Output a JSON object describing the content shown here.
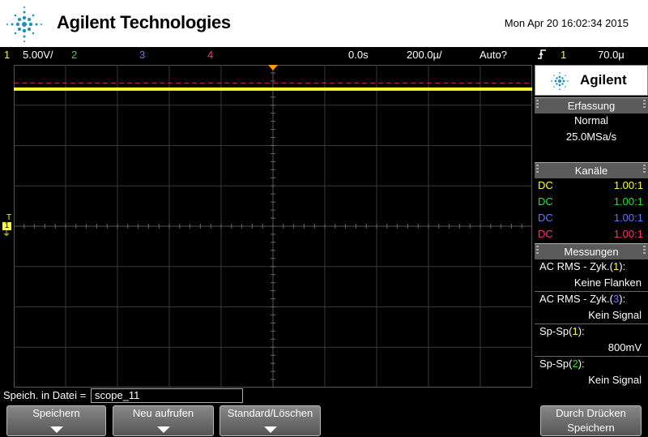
{
  "header": {
    "brand": "Agilent Technologies",
    "datetime": "Mon Apr 20 16:02:34 2015"
  },
  "statusbar": {
    "ch1_num": "1",
    "ch1_scale": "5.00V/",
    "ch2_num": "2",
    "ch3_num": "3",
    "ch4_num": "4",
    "time_delay": "0.0s",
    "time_scale": "200.0µ/",
    "trigger_mode": "Auto?",
    "trigger_icon": "rising-edge-icon",
    "trigger_ch": "1",
    "trigger_level": "70.0μ"
  },
  "scope": {
    "ch_marker_t": "T",
    "ch_marker_num": "1",
    "ch_marker_ground": "⏚",
    "colors": {
      "ch1": "#ffff33",
      "ch2": "#33dd33",
      "ch3": "#6677ff",
      "ch4": "#ff3366",
      "trigger": "#ff9900"
    }
  },
  "panel": {
    "brand": "Agilent",
    "acq_header": "Erfassung",
    "acq_mode": "Normal",
    "acq_rate": "25.0MSa/s",
    "channels_header": "Kanäle",
    "channels": [
      {
        "coupling": "DC",
        "ratio": "1.00:1"
      },
      {
        "coupling": "DC",
        "ratio": "1.00:1"
      },
      {
        "coupling": "DC",
        "ratio": "1.00:1"
      },
      {
        "coupling": "DC",
        "ratio": "1.00:1"
      }
    ],
    "meas_header": "Messungen",
    "meas": [
      {
        "label_pre": "AC RMS - Zyk.(",
        "ch": "1",
        "label_post": "):",
        "value": "Keine Flanken"
      },
      {
        "label_pre": "AC RMS - Zyk.(",
        "ch": "3",
        "label_post": "):",
        "value": "Kein Signal"
      },
      {
        "label_pre": "Sp-Sp(",
        "ch": "1",
        "label_post": "):",
        "value": "800mV"
      },
      {
        "label_pre": "Sp-Sp(",
        "ch": "2",
        "label_post": "):",
        "value": "Kein Signal"
      }
    ]
  },
  "bottom": {
    "file_label": "Speich. in Datei =",
    "file_name": "scope_11",
    "softkeys": {
      "save": "Speichern",
      "recall": "Neu aufrufen",
      "default": "Standard/Löschen",
      "print_line1": "Durch Drücken",
      "print_line2": "Speichern"
    }
  },
  "signals": {
    "ch1_level_div": 3.4,
    "ch_ref_dashed_div": 3.55
  }
}
